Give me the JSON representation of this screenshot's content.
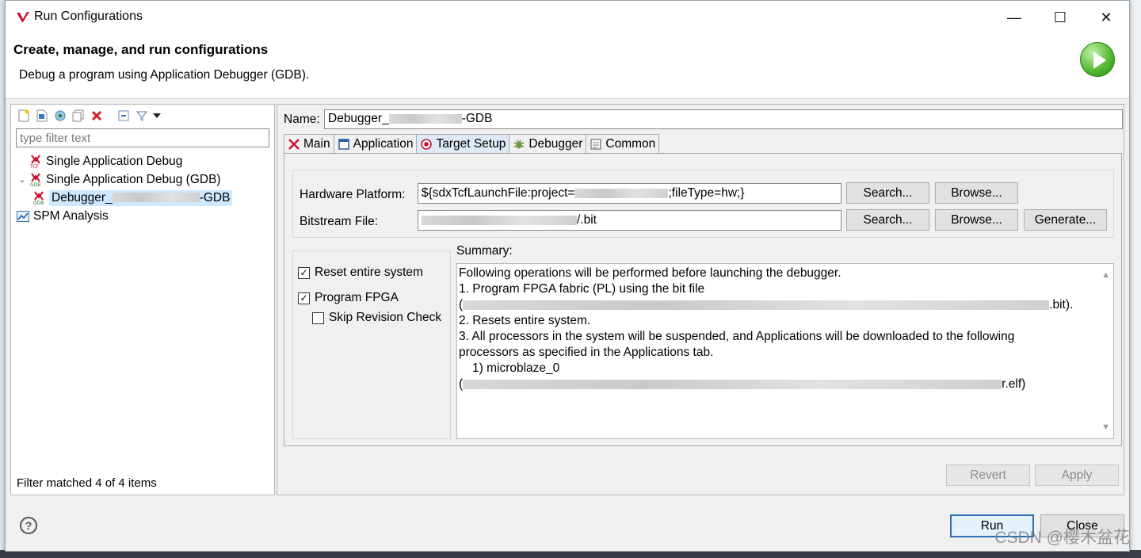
{
  "window": {
    "title": "Run Configurations",
    "minimize": "—",
    "maximize": "☐",
    "close": "✕"
  },
  "header": {
    "title": "Create, manage, and run configurations",
    "subtitle": "Debug a program using Application Debugger (GDB)."
  },
  "left": {
    "filter_placeholder": "type filter text",
    "tree": [
      {
        "label": "Single Application Debug",
        "icon": "tcf-icon"
      },
      {
        "label": "Single Application Debug (GDB)",
        "icon": "gdb-icon",
        "expanded": true
      },
      {
        "label_prefix": "Debugger_",
        "label_suffix": "-GDB",
        "icon": "gdb-icon",
        "selected": true
      },
      {
        "label": "SPM Analysis",
        "icon": "chart-icon"
      }
    ],
    "status": "Filter matched 4 of 4 items"
  },
  "config": {
    "name_label": "Name:",
    "name_prefix": "Debugger_",
    "name_suffix": "-GDB",
    "tabs": [
      {
        "label": "Main",
        "icon": "xilinx-icon"
      },
      {
        "label": "Application",
        "icon": "window-icon"
      },
      {
        "label": "Target Setup",
        "icon": "target-icon",
        "active": true
      },
      {
        "label": "Debugger",
        "icon": "bug-icon"
      },
      {
        "label": "Common",
        "icon": "common-icon"
      }
    ],
    "hw_platform_label": "Hardware Platform:",
    "hw_platform_prefix": "${sdxTcfLaunchFile:project=",
    "hw_platform_suffix": ";fileType=hw;}",
    "bitstream_label": "Bitstream File:",
    "bitstream_suffix": "/.bit",
    "search_label": "Search...",
    "browse_label": "Browse...",
    "generate_label": "Generate...",
    "reset_label": "Reset entire system",
    "reset_checked": true,
    "program_fpga_label": "Program FPGA",
    "program_fpga_checked": true,
    "skip_revision_label": "Skip Revision Check",
    "skip_revision_checked": false,
    "summary_label": "Summary:",
    "summary": {
      "line1": "Following operations will be performed before launching the debugger.",
      "line2": "1. Program FPGA fabric (PL) using the bit file",
      "line3_prefix": "(",
      "line3_suffix": ".bit).",
      "line4": "2. Resets entire system.",
      "line5": "3. All processors in the system will be suspended, and Applications will be downloaded to the following",
      "line6": "processors as specified in the Applications tab.",
      "line7": "1) microblaze_0",
      "line8_prefix": "(",
      "line8_suffix": "r.elf)"
    },
    "revert_label": "Revert",
    "apply_label": "Apply"
  },
  "footer": {
    "run_label": "Run",
    "close_label": "Close",
    "watermark": "CSDN @樱木盆花"
  }
}
